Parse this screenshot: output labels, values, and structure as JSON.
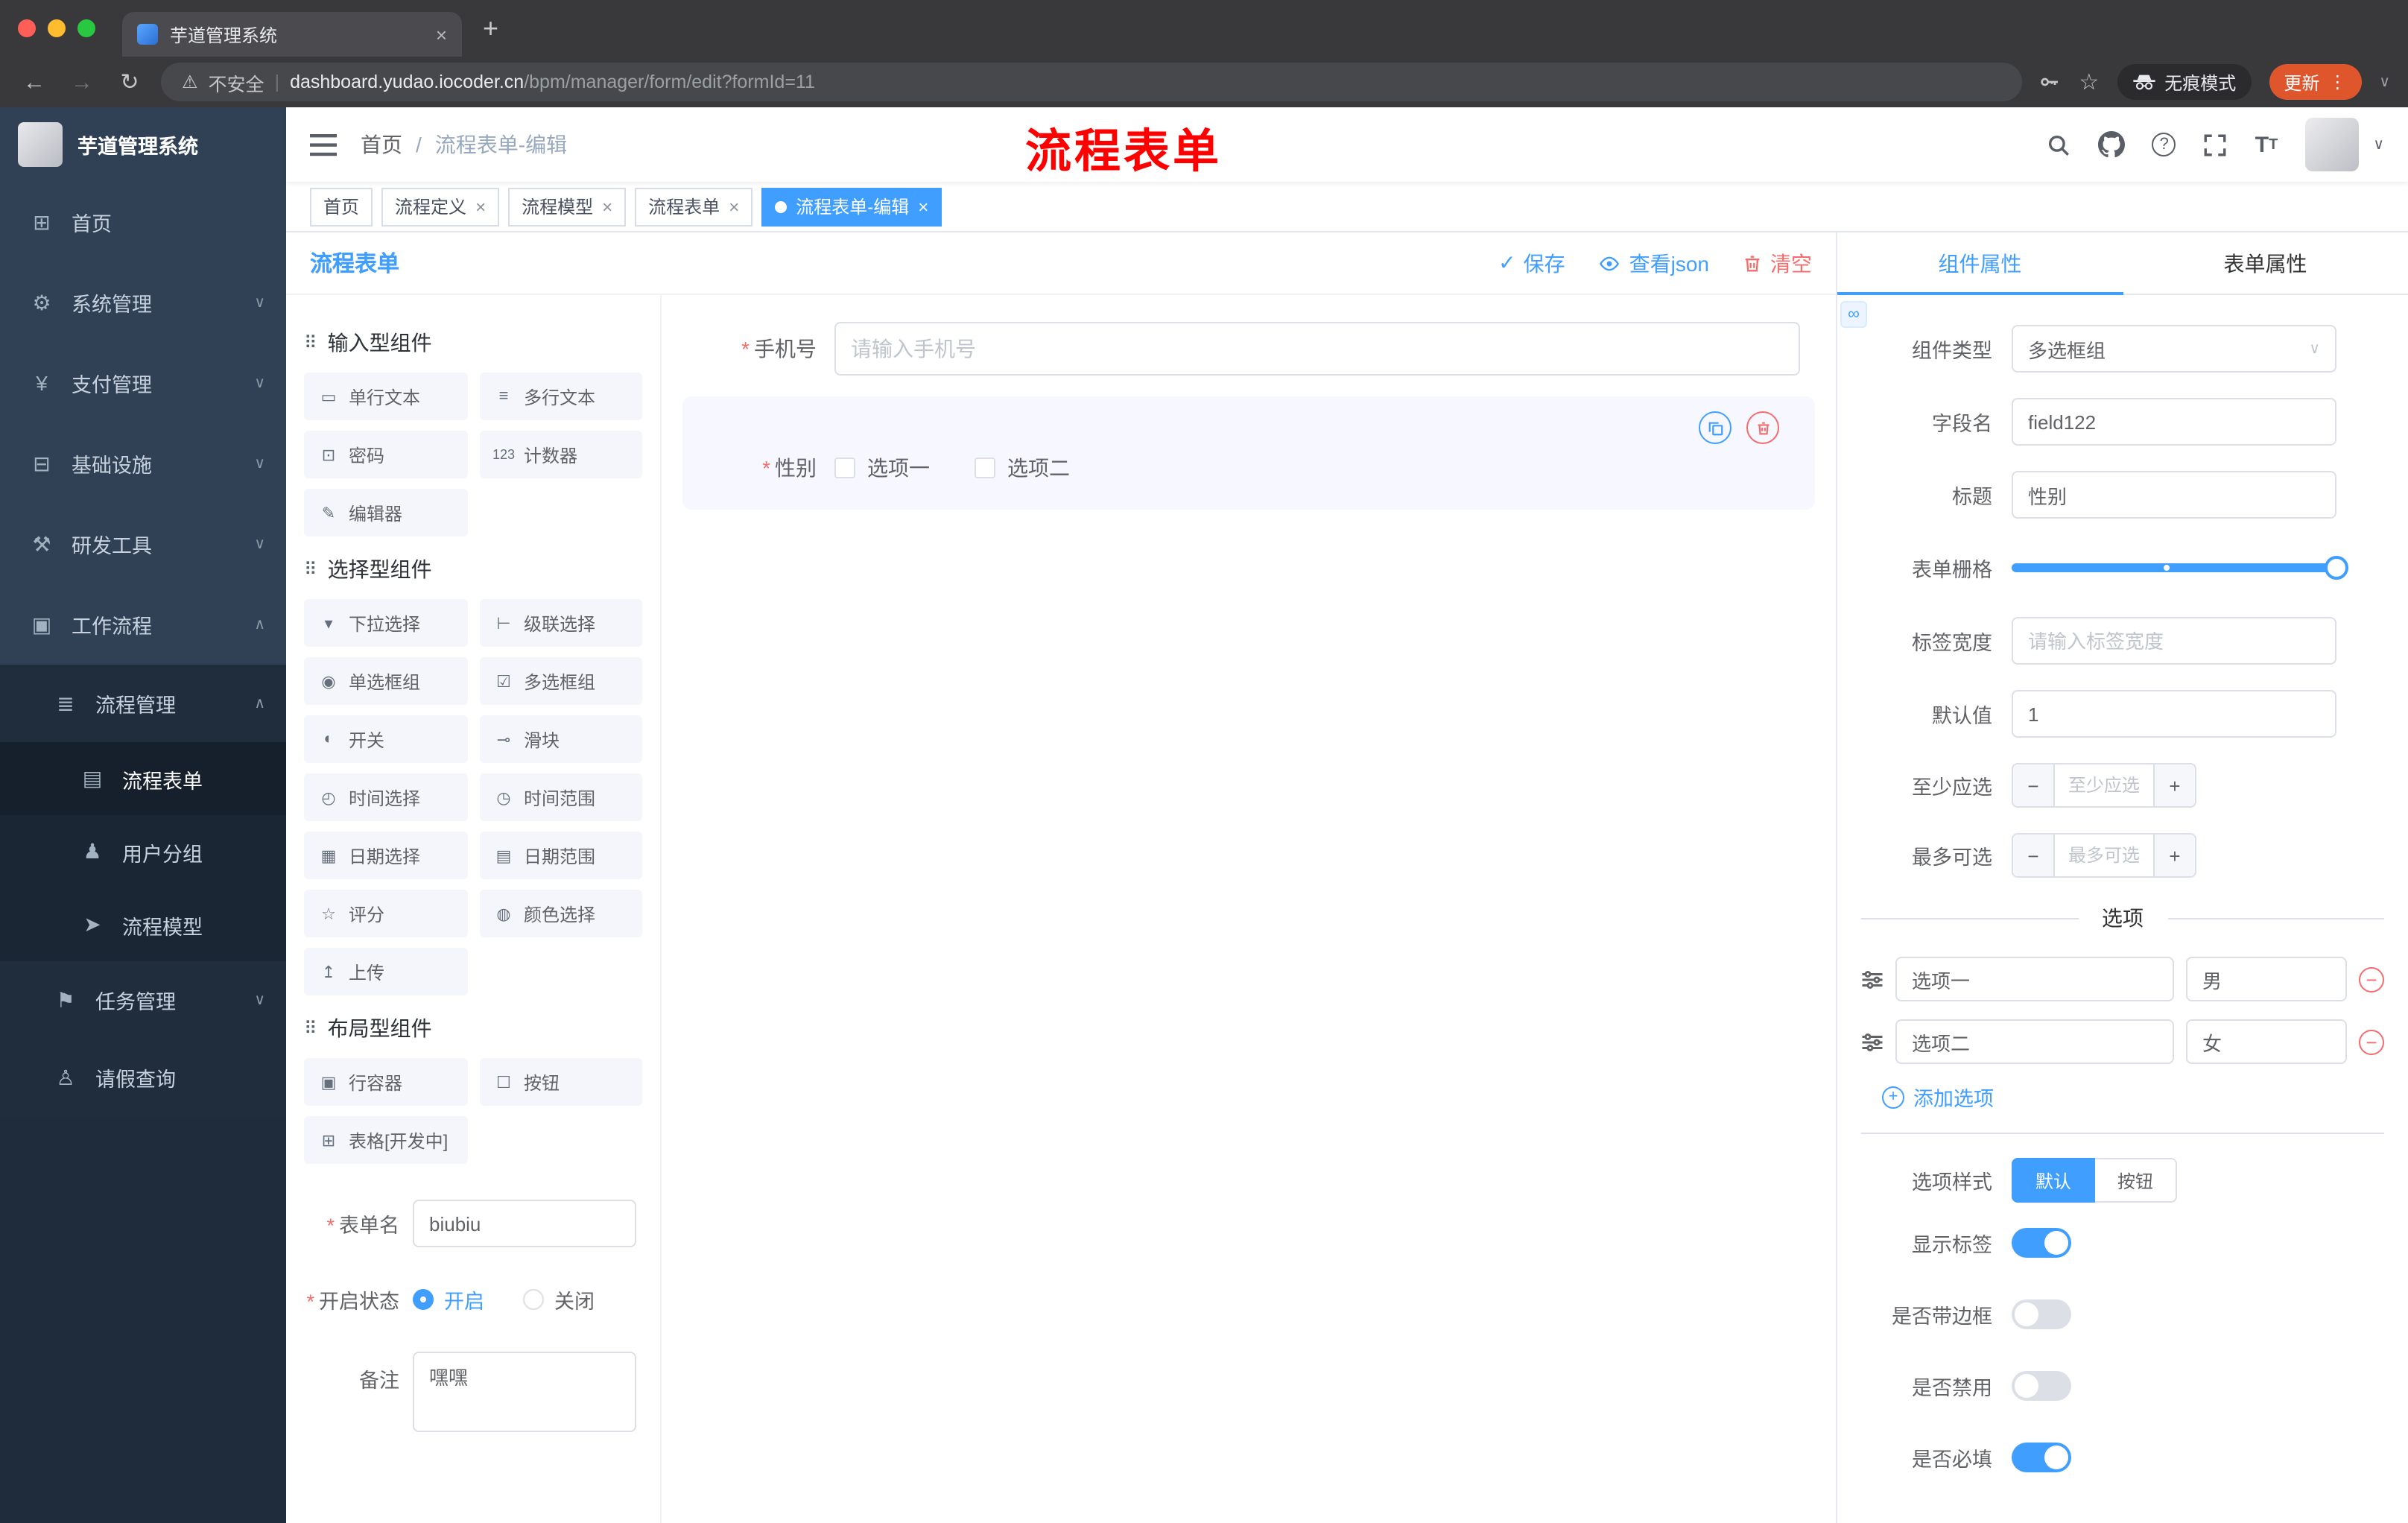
{
  "colors": {
    "accent": "#409eff",
    "danger": "#f56c6c",
    "sidebar": "#304156",
    "annotation": "#ff0000",
    "update_pill": "#e0562c"
  },
  "browser": {
    "tab_title": "芋道管理系统",
    "not_secure": "不安全",
    "url_host": "dashboard.yudao.iocoder.cn",
    "url_path": "/bpm/manager/form/edit?formId=11",
    "incognito": "无痕模式",
    "update": "更新"
  },
  "annotation": "流程表单",
  "sidebar": {
    "logo_title": "芋道管理系统",
    "items": [
      {
        "icon": "⊞",
        "label": "首页"
      },
      {
        "icon": "⚙",
        "label": "系统管理"
      },
      {
        "icon": "¥",
        "label": "支付管理"
      },
      {
        "icon": "⊟",
        "label": "基础设施"
      },
      {
        "icon": "⚒",
        "label": "研发工具"
      },
      {
        "icon": "▣",
        "label": "工作流程"
      },
      {
        "icon": "≣",
        "label": "流程管理"
      },
      {
        "icon": "▤",
        "label": "流程表单"
      },
      {
        "icon": "♟",
        "label": "用户分组"
      },
      {
        "icon": "➤",
        "label": "流程模型"
      },
      {
        "icon": "⚑",
        "label": "任务管理"
      },
      {
        "icon": "♙",
        "label": "请假查询"
      }
    ]
  },
  "navbar": {
    "breadcrumb_home": "首页",
    "breadcrumb_sep": "/",
    "breadcrumb_current": "流程表单-编辑"
  },
  "tags": [
    {
      "label": "首页"
    },
    {
      "label": "流程定义"
    },
    {
      "label": "流程模型"
    },
    {
      "label": "流程表单"
    },
    {
      "label": "流程表单-编辑"
    }
  ],
  "designer": {
    "title": "流程表单",
    "actions": {
      "save": "保存",
      "view_json": "查看json",
      "clear": "清空"
    },
    "palette": {
      "sections": [
        {
          "title": "输入型组件",
          "items": [
            {
              "icon": "▭",
              "label": "单行文本"
            },
            {
              "icon": "≡",
              "label": "多行文本"
            },
            {
              "icon": "⊡",
              "label": "密码"
            },
            {
              "icon": "123",
              "label": "计数器"
            },
            {
              "icon": "✎",
              "label": "编辑器"
            }
          ]
        },
        {
          "title": "选择型组件",
          "items": [
            {
              "icon": "▾",
              "label": "下拉选择"
            },
            {
              "icon": "⊢",
              "label": "级联选择"
            },
            {
              "icon": "◉",
              "label": "单选框组"
            },
            {
              "icon": "☑",
              "label": "多选框组"
            },
            {
              "icon": "◐",
              "label": "开关"
            },
            {
              "icon": "⊸",
              "label": "滑块"
            },
            {
              "icon": "◴",
              "label": "时间选择"
            },
            {
              "icon": "◷",
              "label": "时间范围"
            },
            {
              "icon": "▦",
              "label": "日期选择"
            },
            {
              "icon": "▤",
              "label": "日期范围"
            },
            {
              "icon": "☆",
              "label": "评分"
            },
            {
              "icon": "◍",
              "label": "颜色选择"
            },
            {
              "icon": "↥",
              "label": "上传"
            }
          ]
        },
        {
          "title": "布局型组件",
          "items": [
            {
              "icon": "▣",
              "label": "行容器"
            },
            {
              "icon": "☐",
              "label": "按钮"
            },
            {
              "icon": "⊞",
              "label": "表格[开发中]"
            }
          ]
        }
      ],
      "meta": {
        "form_name_label": "表单名",
        "form_name_value": "biubiu",
        "status_label": "开启状态",
        "status_on": "开启",
        "status_off": "关闭",
        "remark_label": "备注",
        "remark_value": "嘿嘿"
      }
    },
    "canvas": {
      "phone": {
        "label": "手机号",
        "placeholder": "请输入手机号"
      },
      "gender": {
        "label": "性别",
        "options": [
          "选项一",
          "选项二"
        ]
      }
    },
    "props": {
      "tab_component": "组件属性",
      "tab_form": "表单属性",
      "type_label": "组件类型",
      "type_value": "多选框组",
      "field_label": "字段名",
      "field_value": "field122",
      "title_label": "标题",
      "title_value": "性别",
      "grid_label": "表单栅格",
      "width_label": "标签宽度",
      "width_placeholder": "请输入标签宽度",
      "default_label": "默认值",
      "default_value": "1",
      "min_label": "至少应选",
      "min_placeholder": "至少应选",
      "max_label": "最多可选",
      "max_placeholder": "最多可选",
      "options_title": "选项",
      "options": [
        {
          "label": "选项一",
          "value": "男"
        },
        {
          "label": "选项二",
          "value": "女"
        }
      ],
      "add_option": "添加选项",
      "style_label": "选项样式",
      "style_default": "默认",
      "style_button": "按钮",
      "toggle_show_label": "显示标签",
      "toggle_border": "是否带边框",
      "toggle_disabled": "是否禁用",
      "toggle_required": "是否必填"
    }
  }
}
